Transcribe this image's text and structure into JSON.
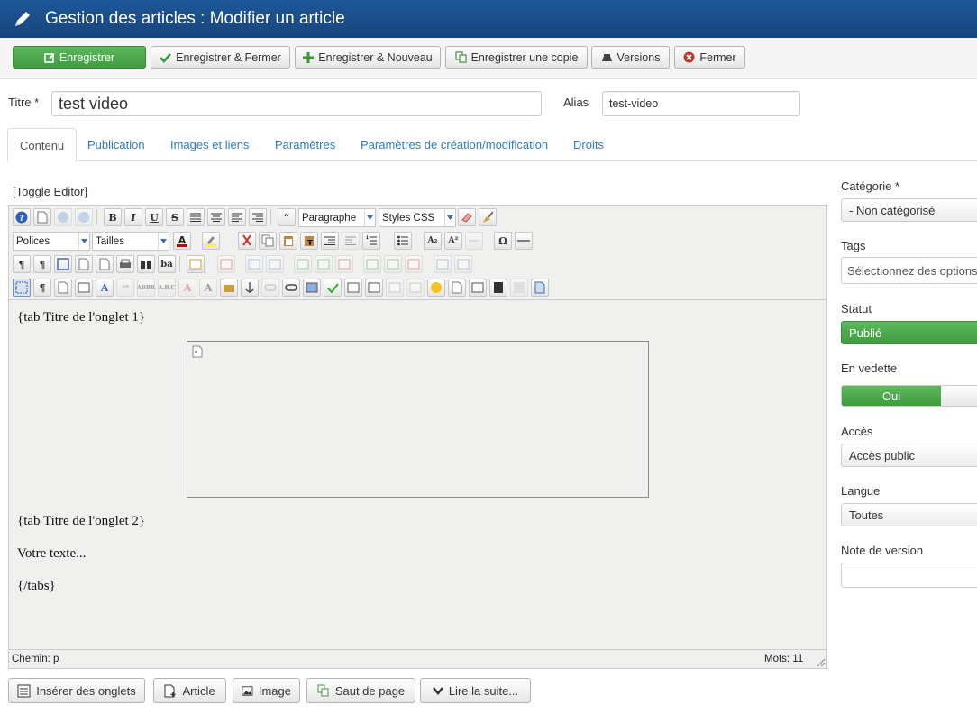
{
  "header": {
    "title": "Gestion des articles : Modifier un article"
  },
  "toolbar": {
    "save": "Enregistrer",
    "save_close": "Enregistrer & Fermer",
    "save_new": "Enregistrer & Nouveau",
    "save_copy": "Enregistrer une copie",
    "versions": "Versions",
    "close": "Fermer"
  },
  "form": {
    "title_label": "Titre *",
    "title_value": "test video",
    "alias_label": "Alias",
    "alias_value": "test-video"
  },
  "tabs": [
    "Contenu",
    "Publication",
    "Images et liens",
    "Paramètres",
    "Paramètres de création/modification",
    "Droits"
  ],
  "editor": {
    "toggle": "[Toggle Editor]",
    "format_select": "Paragraphe",
    "styles_select": "Styles CSS",
    "font_select": "Polices",
    "size_select": "Tailles",
    "content": {
      "line1": "{tab Titre de l'onglet 1}",
      "line2": "{tab Titre de l'onglet 2}",
      "line3": "Votre texte...",
      "line4": "{/tabs}"
    },
    "path": "Chemin: p",
    "words": "Mots: 11"
  },
  "buttons": {
    "tabs_insert": "Insérer des onglets",
    "article": "Article",
    "image": "Image",
    "pagebreak": "Saut de page",
    "readmore": "Lire la suite..."
  },
  "sidebar": {
    "category_label": "Catégorie *",
    "category_value": "- Non catégorisé",
    "tags_label": "Tags",
    "tags_placeholder": "Sélectionnez des options",
    "status_label": "Statut",
    "status_value": "Publié",
    "featured_label": "En vedette",
    "featured_yes": "Oui",
    "access_label": "Accès",
    "access_value": "Accès public",
    "language_label": "Langue",
    "language_value": "Toutes",
    "version_note_label": "Note de version"
  },
  "colors": {
    "header": "#1a4d8a",
    "green": "#46a546",
    "link": "#2f7bbd"
  },
  "icons": [
    "pencil-icon",
    "edit-icon",
    "check-icon",
    "plus-icon",
    "copy-icon",
    "versions-icon",
    "close-icon"
  ]
}
